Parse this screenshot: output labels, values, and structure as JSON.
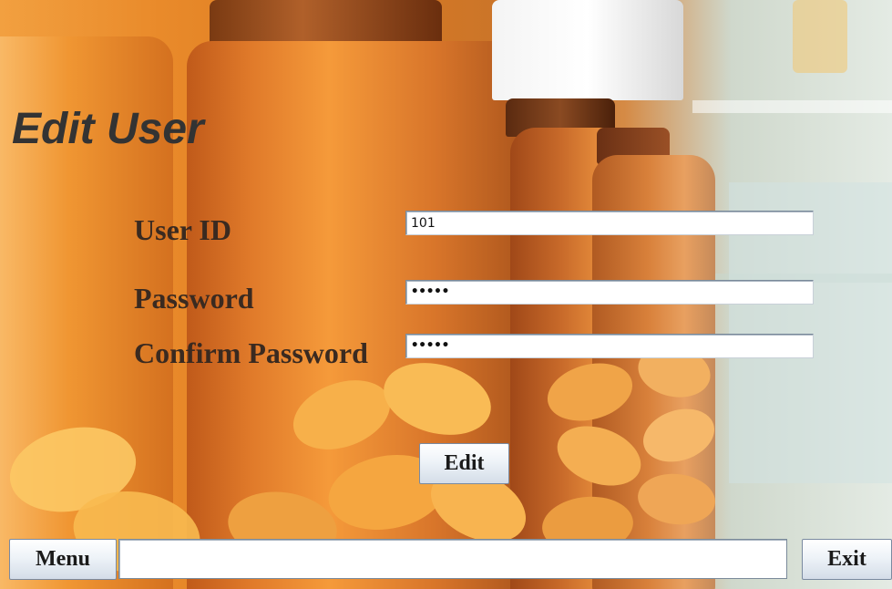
{
  "window": {
    "title": "Edit User"
  },
  "form": {
    "user_id_label": "User ID",
    "user_id_value": "101",
    "password_label": "Password",
    "password_value": "•••••",
    "confirm_password_label": "Confirm Password",
    "confirm_password_value": "•••••",
    "edit_button_label": "Edit"
  },
  "footer": {
    "menu_button_label": "Menu",
    "status_text": "",
    "exit_button_label": "Exit"
  },
  "theme": {
    "title_color": "#333333",
    "label_color": "#3a2a20",
    "background_image": "pharmacy-pill-bottles"
  }
}
